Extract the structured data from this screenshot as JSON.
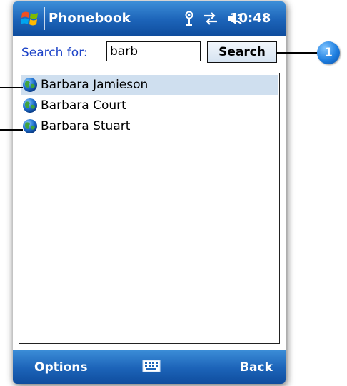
{
  "app": {
    "title": "Phonebook",
    "clock": "10:48"
  },
  "status_icons": [
    "signal-icon",
    "connectivity-icon",
    "volume-icon"
  ],
  "search": {
    "label": "Search for:",
    "value": "barb",
    "button_label": "Search"
  },
  "results": [
    {
      "name": "Barbara Jamieson",
      "selected": true
    },
    {
      "name": "Barbara Court",
      "selected": false
    },
    {
      "name": "Barbara Stuart",
      "selected": false
    }
  ],
  "softkeys": {
    "left": "Options",
    "right": "Back"
  },
  "callout": {
    "number": "1"
  },
  "colors": {
    "titlebar": "#1c63b8",
    "selection": "#cfdfef",
    "label": "#1f45c8"
  }
}
